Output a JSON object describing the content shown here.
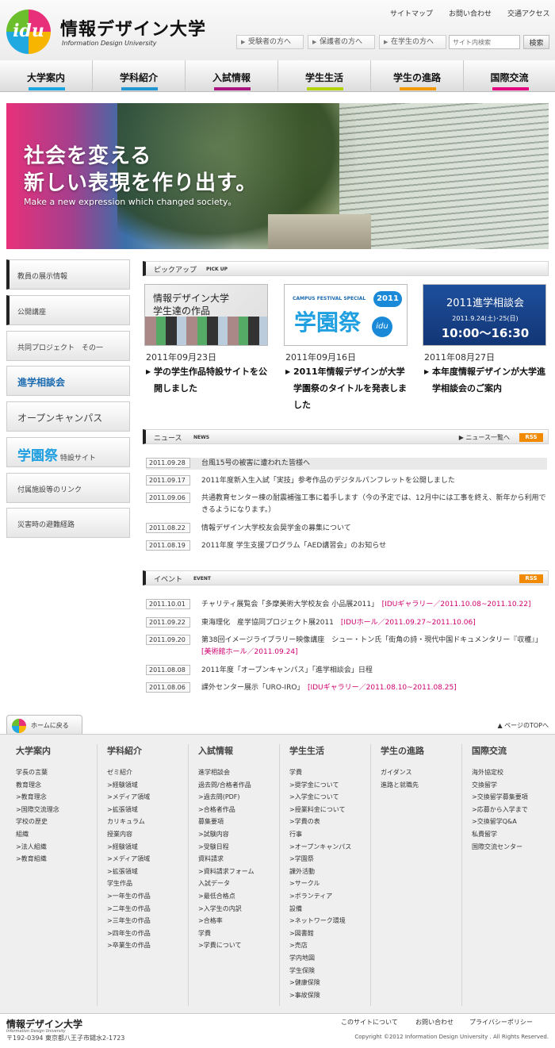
{
  "header": {
    "logo_text": "idu",
    "site_name": "情報デザイン大学",
    "site_sub": "Information Design University",
    "util_links": [
      "サイトマップ",
      "お問い合わせ",
      "交通アクセス"
    ],
    "audience_buttons": [
      "受験者の方へ",
      "保護者の方へ",
      "在学生の方へ"
    ],
    "search_placeholder": "サイト内検索",
    "search_button": "検索"
  },
  "gnav": [
    {
      "label": "大学案内",
      "color": "#1aa6e0"
    },
    {
      "label": "学科紹介",
      "color": "#2196d3"
    },
    {
      "label": "入試情報",
      "color": "#a8157e"
    },
    {
      "label": "学生生活",
      "color": "#b5d30b"
    },
    {
      "label": "学生の進路",
      "color": "#f39a00"
    },
    {
      "label": "国際交流",
      "color": "#e5007f"
    }
  ],
  "hero": {
    "line1": "社会を変える",
    "line2": "新しい表現を作り出す。",
    "line3": "Make a new expression which changed society。"
  },
  "sidebar": [
    "教員の展示情報",
    "公開講座",
    "共同プロジェクト　その一",
    "進学相談会",
    "オープンキャンパス",
    "学園祭",
    "付属施設等のリンク",
    "災害時の避難経路"
  ],
  "sidebar_festival_suffix": "特設サイト",
  "pickup": {
    "title": "ピックアップ",
    "title_en": "PICK UP",
    "items": [
      {
        "img_text1": "情報デザイン大学",
        "img_text2": "学生達の作品",
        "date": "2011年09月23日",
        "title": "学の学生作品特設サイトを公開しました"
      },
      {
        "img_text1": "CAMPUS FESTIVAL SPECIAL",
        "img_text2": "学園祭",
        "img_badge": "2011",
        "img_badge2": "idu",
        "date": "2011年09月16日",
        "title": "2011年情報デザインが大学学園祭のタイトルを発表しました"
      },
      {
        "img_text1": "2011進学相談会",
        "img_text2": "2011.9.24(土)･25(日)",
        "img_text3": "10:00〜16:30",
        "date": "2011年08月27日",
        "title": "本年度情報デザインが大学進学相談会のご案内"
      }
    ]
  },
  "news": {
    "title": "ニュース",
    "title_en": "NEWS",
    "more": "ニュース一覧へ",
    "rss": "RSS",
    "items": [
      {
        "date": "2011.09.28",
        "text": "台風15号の被害に遭われた皆様へ"
      },
      {
        "date": "2011.09.17",
        "text": "2011年度新入生入試「実技」参考作品のデジタルパンフレットを公開しました"
      },
      {
        "date": "2011.09.06",
        "text": "共通教育センター棟の耐震補強工事に着手します（今の予定では、12月中には工事を終え、新年から利用できるようになります。）"
      },
      {
        "date": "2011.08.22",
        "text": "情報デザイン大学校友会奨学金の募集について"
      },
      {
        "date": "2011.08.19",
        "text": "2011年度 学生支援プログラム「AED講習会」のお知らせ"
      }
    ]
  },
  "event": {
    "title": "イベント",
    "title_en": "EVENT",
    "rss": "RSS",
    "items": [
      {
        "date": "2011.10.01",
        "text": "チャリティ展覧会「多摩美術大学校友会 小品展2011」",
        "link": "[IDUギャラリー／2011.10.08~2011.10.22]"
      },
      {
        "date": "2011.09.22",
        "text": "東海理化　産学協同プロジェクト展2011",
        "link": "[IDUホール／2011.09.27~2011.10.06]"
      },
      {
        "date": "2011.09.20",
        "text": "第38回イメージライブラリー映像講座　シュー・トン氏「街角の詩・現代中国ドキュメンタリー『収穫』」",
        "link": "[美術館ホール／2011.09.24]"
      },
      {
        "date": "2011.08.08",
        "text": "2011年度「オープンキャンパス」「進学相談会」日程",
        "link": ""
      },
      {
        "date": "2011.08.06",
        "text": "課外センター展示「URO-IRO」",
        "link": "[IDUギャラリー／2011.08.10~2011.08.25]"
      }
    ]
  },
  "footer_tab": "ホームに戻る",
  "pagetop": "▲ ページのTOPへ",
  "sitemap": [
    {
      "title": "大学案内",
      "links": [
        "学長の言葉",
        "教育理念",
        ">教育理念",
        ">国際交流理念",
        "学校の歴史",
        "組織",
        ">法人組織",
        ">教育組織"
      ]
    },
    {
      "title": "学科紹介",
      "links": [
        "ゼミ紹介",
        ">経験領域",
        ">メディア領域",
        ">拡張領域",
        "カリキュラム",
        "授業内容",
        ">経験領域",
        ">メディア領域",
        ">拡張領域",
        "学生作品",
        ">一年生の作品",
        ">二年生の作品",
        ">三年生の作品",
        ">四年生の作品",
        ">卒業生の作品"
      ]
    },
    {
      "title": "入試情報",
      "links": [
        "進学相談会",
        "過去問/合格者作品",
        ">過去問(PDF)",
        ">合格者作品",
        "募集要項",
        ">試験内容",
        ">受験日程",
        "資料請求",
        ">資料請求フォーム",
        "入試データ",
        ">最低合格点",
        ">入学生の内訳",
        ">合格率",
        "学費",
        ">学費について"
      ]
    },
    {
      "title": "学生生活",
      "links": [
        "学費",
        ">奨学金について",
        ">入学金について",
        ">授業料金について",
        ">学費の表",
        "行事",
        ">オープンキャンパス",
        ">学園祭",
        "課外活動",
        ">サークル",
        ">ボランティア",
        "設備",
        ">ネットワーク環境",
        ">図書館",
        ">売店",
        "学内地図",
        "学生保険",
        ">健康保険",
        ">事故保険"
      ]
    },
    {
      "title": "学生の進路",
      "links": [
        "ガイダンス",
        "進路と就職先"
      ]
    },
    {
      "title": "国際交流",
      "links": [
        "海外協定校",
        "交換留学",
        ">交換留学募集要項",
        ">応募から入学まで",
        ">交換留学Q&A",
        "私費留学",
        "国際交流センター"
      ]
    }
  ],
  "footer": {
    "name": "情報デザイン大学",
    "sub": "Information Design University",
    "address": "〒192-0394 東京都八王子市鑓水2-1723",
    "links": [
      "このサイトについて",
      "お問い合わせ",
      "プライバシーポリシー"
    ],
    "copyright": "Copyright ©2012 Information Design University . All Rights Reserved."
  }
}
